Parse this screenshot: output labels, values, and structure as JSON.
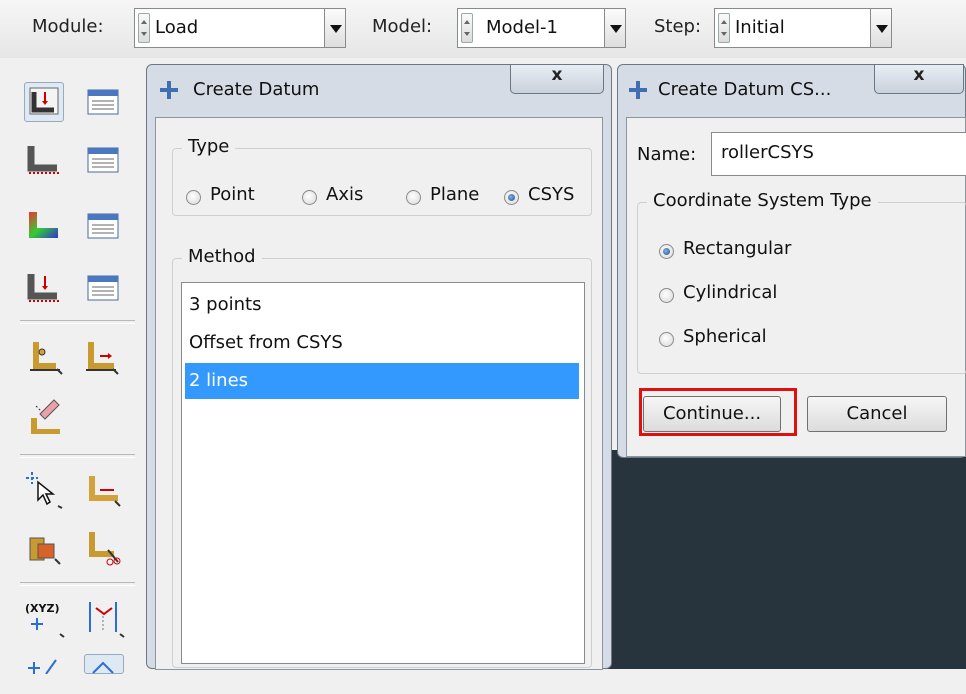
{
  "toolbar": {
    "module_label": "Module:",
    "module_value": "Load",
    "model_label": "Model:",
    "model_value": "Model-1",
    "step_label": "Step:",
    "step_value": "Initial"
  },
  "create_datum": {
    "title": "Create Datum",
    "close": "x",
    "type_group": "Type",
    "types": [
      "Point",
      "Axis",
      "Plane",
      "CSYS"
    ],
    "selected_type": "CSYS",
    "method_group": "Method",
    "methods": [
      "3 points",
      "Offset from CSYS",
      "2 lines"
    ],
    "selected_method": "2 lines"
  },
  "create_csys": {
    "title": "Create Datum CS...",
    "close": "x",
    "name_label": "Name:",
    "name_value": "rollerCSYS",
    "cs_group": "Coordinate System Type",
    "cs_types": [
      "Rectangular",
      "Cylindrical",
      "Spherical"
    ],
    "selected_cs": "Rectangular",
    "continue_label": "Continue...",
    "cancel_label": "Cancel"
  },
  "palette": {
    "tools": [
      "create-load-icon",
      "load-manager-icon",
      "create-bc-icon",
      "bc-manager-icon",
      "create-predefined-field-icon",
      "predefined-field-manager-icon",
      "create-load-case-icon",
      "load-case-manager-icon",
      "create-amplitude-icon",
      "create-field-icon",
      "create-datum-csys-icon",
      "partition-icon",
      "query-icon",
      "datum-csys-icon",
      "datum-axis-icon",
      "constraint-icon"
    ]
  },
  "colors": {
    "selection": "#3399ff",
    "highlight": "#e01010",
    "viewport": "#27333d"
  }
}
